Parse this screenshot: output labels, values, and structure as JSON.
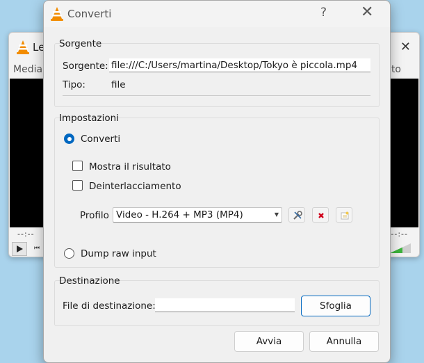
{
  "background_window": {
    "title": "Le",
    "menu_left": "Media",
    "menu_right": "to",
    "time_left": "--:--",
    "time_right": "--:--"
  },
  "dialog": {
    "title": "Converti",
    "help_glyph": "?",
    "close_glyph": "✕"
  },
  "source": {
    "group_title": "Sorgente",
    "source_label": "Sorgente:",
    "source_value": "file:///C:/Users/martina/Desktop/Tokyo è piccola.mp4",
    "type_label": "Tipo:",
    "type_value": "file"
  },
  "settings": {
    "group_title": "Impostazioni",
    "convert_label": "Converti",
    "convert_selected": true,
    "show_output_label": "Mostra il risultato",
    "show_output_checked": false,
    "deinterlace_label": "Deinterlacciamento",
    "deinterlace_checked": false,
    "profile_label": "Profilo",
    "profile_value": "Video - H.264 + MP3 (MP4)",
    "dump_raw_label": "Dump raw input",
    "dump_raw_selected": false
  },
  "destination": {
    "group_title": "Destinazione",
    "file_label": "File di destinazione:",
    "file_value": "",
    "browse_label": "Sfoglia"
  },
  "footer": {
    "start_label": "Avvia",
    "cancel_label": "Annulla"
  },
  "icons": {
    "vlc": "vlc-cone-icon",
    "edit_profile": "wrench-icon",
    "delete_profile": "red-x-icon",
    "new_profile": "new-profile-icon"
  },
  "colors": {
    "accent": "#0067c0",
    "vlc_orange": "#f28c00",
    "delete_red": "#d0021b"
  }
}
